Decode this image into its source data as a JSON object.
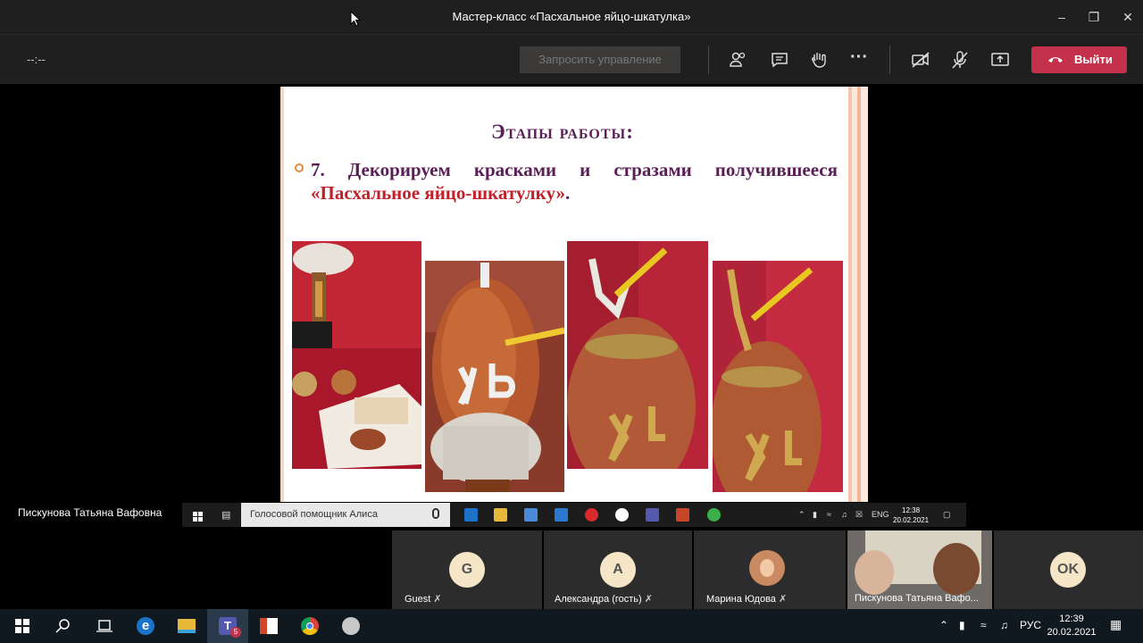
{
  "window": {
    "title": "Мастер-класс «Пасхальное яйцо-шкатулка»"
  },
  "toolbar": {
    "timer": "--:--",
    "request_control_label": "Запросить управление",
    "leave_label": "Выйти"
  },
  "slide": {
    "title": "Этапы работы:",
    "step_text_1": "7. Декорируем красками и стразами получившееся ",
    "step_text_highlight": "«Пасхальное яйцо-шкатулку»",
    "step_text_end": "."
  },
  "presenter": {
    "name": "Пискунова Татьяна Вафовна"
  },
  "inner_taskbar": {
    "search_placeholder": "Голосовой помощник Алиса",
    "lang": "ENG",
    "time": "12:38",
    "date": "20.02.2021"
  },
  "participants": [
    {
      "initial": "G",
      "name": "Guest"
    },
    {
      "initial": "А",
      "name": "Александра (гость)"
    },
    {
      "initial": "",
      "name": "Марина Юдова"
    },
    {
      "initial": "",
      "name": "Пискунова Татьяна Вафо..."
    },
    {
      "initial": "OK",
      "name": ""
    }
  ],
  "taskbar": {
    "lang": "РУС",
    "time": "12:39",
    "date": "20.02.2021",
    "teams_badge": "5"
  },
  "colors": {
    "leave": "#c4314b",
    "slide_title": "#5b1f58",
    "slide_highlight": "#c0202a"
  }
}
